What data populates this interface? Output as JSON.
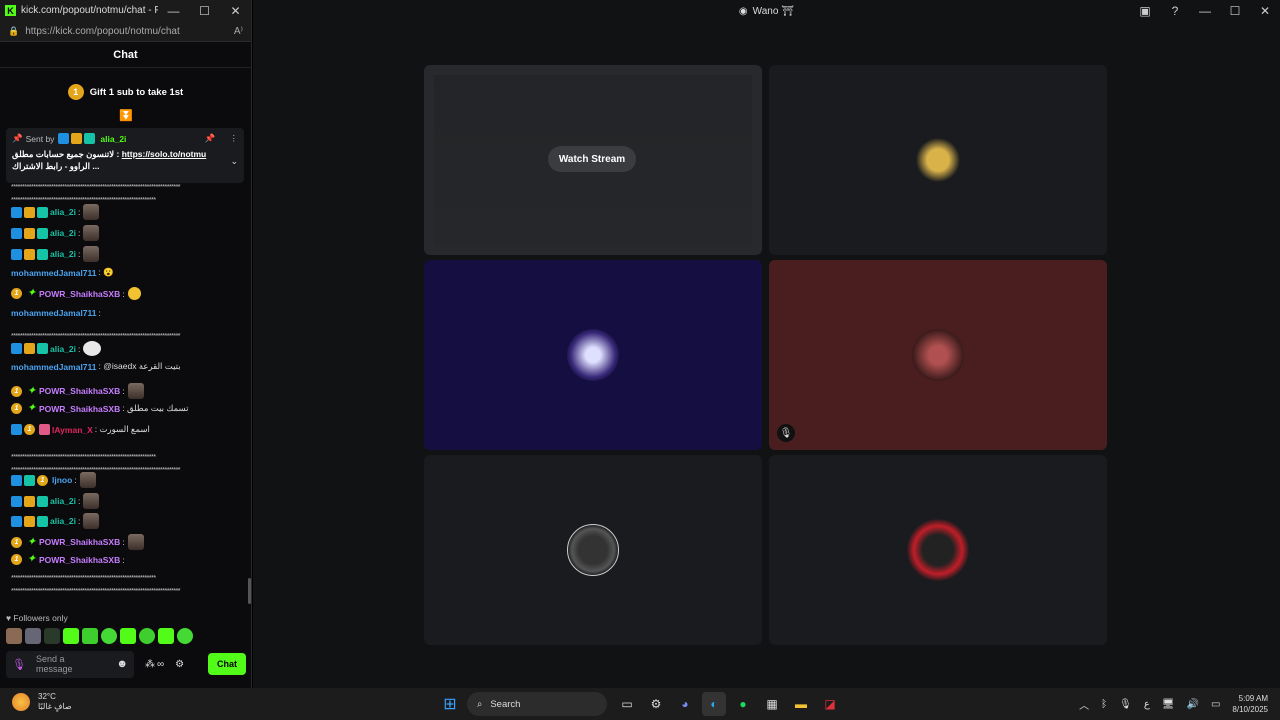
{
  "chat_window": {
    "title": "kick.com/popout/notmu/chat - Person...",
    "url": "https://kick.com/popout/notmu/chat",
    "heading": "Chat",
    "gift_text": "Gift 1 sub to take 1st",
    "gift_rank": "1",
    "pinned": {
      "sent_by_label": "Sent by",
      "username": "alia_2i",
      "text_before": "لاتنسون جميع حسابات مطلق : ",
      "link": "https://solo.to/notmu",
      "text_after": "الراوو - رابط الاشتراك ..."
    },
    "messages": [
      {
        "user": "alia_2i",
        "color": "#16c3a6",
        "text": ":",
        "badges": [
          "mod",
          "vip",
          "sub"
        ],
        "emote": "face"
      },
      {
        "user": "alia_2i",
        "color": "#16c3a6",
        "text": ":",
        "badges": [
          "mod",
          "vip",
          "sub"
        ],
        "emote": "face"
      },
      {
        "user": "alia_2i",
        "color": "#16c3a6",
        "text": ":",
        "badges": [
          "mod",
          "vip",
          "sub"
        ],
        "emote": "face"
      },
      {
        "user": "mohammedJamal711",
        "color": "#4aa3f0",
        "text": ": 😮",
        "badges": []
      },
      {
        "user": "POWR_ShaikhaSXB",
        "color": "#c77dff",
        "text": ":",
        "badges": [
          "coin",
          "star"
        ],
        "emote": "smile"
      },
      {
        "user": "mohammedJamal711",
        "color": "#4aa3f0",
        "text": ":",
        "badges": []
      },
      {
        "user": "alia_2i",
        "color": "#16c3a6",
        "text": ":",
        "badges": [
          "mod",
          "vip",
          "sub"
        ],
        "emote": "blob"
      },
      {
        "user": "mohammedJamal711",
        "color": "#4aa3f0",
        "text": ": @isaedx بتيت القرعة",
        "badges": []
      },
      {
        "user": "POWR_ShaikhaSXB",
        "color": "#c77dff",
        "text": ":",
        "badges": [
          "coin",
          "star"
        ],
        "emote": "face"
      },
      {
        "user": "POWR_ShaikhaSXB",
        "color": "#c77dff",
        "text": ": تسمك بيت مطلق",
        "badges": [
          "coin",
          "star"
        ]
      },
      {
        "user": "lAyman_X",
        "color": "#e0245e",
        "text": ": اسمع السورت",
        "badges": [
          "mod",
          "coin",
          "gift"
        ]
      },
      {
        "user": "ljnoo",
        "color": "#4aa3f0",
        "text": ":",
        "badges": [
          "mod",
          "sub",
          "coin"
        ],
        "emote": "face"
      },
      {
        "user": "alia_2i",
        "color": "#16c3a6",
        "text": ":",
        "badges": [
          "mod",
          "vip",
          "sub"
        ],
        "emote": "face"
      },
      {
        "user": "alia_2i",
        "color": "#16c3a6",
        "text": ":",
        "badges": [
          "mod",
          "vip",
          "sub"
        ],
        "emote": "face"
      },
      {
        "user": "POWR_ShaikhaSXB",
        "color": "#c77dff",
        "text": ":",
        "badges": [
          "coin",
          "star"
        ],
        "emote": "face"
      },
      {
        "user": "POWR_ShaikhaSXB",
        "color": "#c77dff",
        "text": ":",
        "badges": [
          "coin",
          "star"
        ]
      }
    ],
    "spam_line": "****************************************************************************",
    "followers_only": "Followers only",
    "input_placeholder": "Send a message",
    "chat_button": "Chat",
    "inf_icon_text": "∞"
  },
  "discord": {
    "window_title": "Wano",
    "watch_stream": "Watch Stream"
  },
  "taskbar": {
    "temp": "32°C",
    "weather_desc": "صافٍ غالبًا",
    "search": "Search",
    "time": "5:09 AM",
    "date": "8/10/2025",
    "lang": "ع"
  }
}
